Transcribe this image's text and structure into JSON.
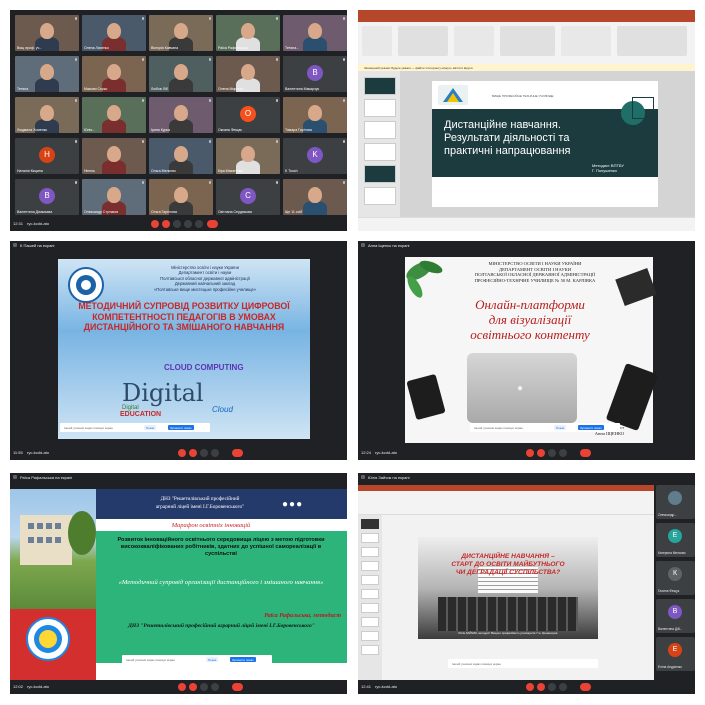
{
  "panels": {
    "p1": {
      "controls": {
        "time": "12:31",
        "code": "ryc-kcdd-ato"
      },
      "tiles": [
        {
          "name": "Вищ проф. уч..."
        },
        {
          "name": "Олена Лисенко"
        },
        {
          "name": "Вікторія Кавчана"
        },
        {
          "name": "Раїса Рафальська"
        },
        {
          "name": "Тетяна..."
        },
        {
          "name": "Тетяна"
        },
        {
          "name": "Максим Сєрко"
        },
        {
          "name": "Любов Ліб"
        },
        {
          "name": "Олена Мирошн..."
        },
        {
          "name": "Валентина Макарчук",
          "initial": "В",
          "color": "#7e57c2"
        },
        {
          "name": "Людмила Хоменко"
        },
        {
          "name": "Юлія..."
        },
        {
          "name": "Ірина Курка"
        },
        {
          "name": "Оксана Фещак",
          "initial": "О",
          "color": "#f4511e"
        },
        {
          "name": "Тамара Гарітова"
        },
        {
          "name": "Наталія Кікцина",
          "initial": "Н",
          "color": "#d84315"
        },
        {
          "name": "Нінель"
        },
        {
          "name": "Ольга Мельник"
        },
        {
          "name": "Кіра Макатенко"
        },
        {
          "name": "K Touch",
          "initial": "K",
          "color": "#7e57c2"
        },
        {
          "name": "Валентина Діхамьєва",
          "initial": "В",
          "color": "#7e57c2"
        },
        {
          "name": "Олександр Стуликов"
        },
        {
          "name": "Ольга Гаргінова"
        },
        {
          "name": "Світлана Сердюкова",
          "initial": "С",
          "color": "#7e57c2"
        },
        {
          "name": "Ще 11 осіб"
        }
      ]
    },
    "p2": {
      "slide": {
        "header": "ВИЩЕ ПРОФЕСІЙНЕ ТЕХНІЧНЕ УЧИЛИЩЕ",
        "title_lines": [
          "Дистанційне навчання.",
          "Результати діяльності та",
          "практичні напрацювання"
        ],
        "author_lines": [
          "Методист ВПТБУ",
          "Г. Полушенко"
        ]
      },
      "notice": "Захищений режим: Будьте уважні — файли з Інтернету можуть містити віруси."
    },
    "p3": {
      "presenter": "К Пашей на екрані",
      "controls": {
        "time": "11:55",
        "code": "ryc-kcdd-ato"
      },
      "slide": {
        "ministry_lines": [
          "Міністерство освіти і науки України",
          "Департамент освіти і науки",
          "Полтавської обласної державної адміністрації",
          "Державний навчальний заклад",
          "«Полтавське вище мистецьке професійне училище»"
        ],
        "title": "МЕТОДИЧНИЙ СУПРОВІД РОЗВИТКУ ЦИФРОВОЇ КОМПЕТЕНТНОСТІ ПЕДАГОГІВ В УМОВАХ ДИСТАНЦІЙНОГО ТА ЗМІШАНОГО НАВЧАННЯ",
        "cloud_words": [
          "CLOUD COMPUTING",
          "Digital",
          "EDUCATION",
          "Digital",
          "Cloud"
        ]
      },
      "banner": {
        "text": "Інший учасник зараз показує екран",
        "btn1": "Показ",
        "btn2": "Зупинити показ"
      }
    },
    "p4": {
      "presenter": "Анна Іщенко на екрані",
      "controls": {
        "time": "12:24",
        "code": "ryc-kcdd-ato"
      },
      "slide": {
        "header_lines": [
          "МІНІСТЕРСТВО ОСВІТИ І НАУКИ УКРАЇНИ",
          "ДЕПАРТАМЕНТ ОСВІТИ І НАУКИ",
          "ПОЛТАВСЬКОЇ ОБЛАСНОЇ ДЕРЖАВНОЇ АДМІНІСТРАЦІЇ",
          "ПРОФЕСІЙНО-ТЕХНІЧНЕ УЧИЛИЩЕ № 50 М. КАРЛІВКА"
        ],
        "title_lines": [
          "Онлайн-платформи",
          "для візуалізації",
          "освітнього контенту"
        ],
        "author_lines": [
          "Підготувала: методист",
          "Анна ІЩЕНКО"
        ]
      },
      "banner": {
        "text": "Інший учасник зараз показує екран",
        "btn1": "Показ",
        "btn2": "Зупинити показ"
      }
    },
    "p5": {
      "presenter": "Раїса Рафальська на екрані",
      "controls": {
        "time": "12:02",
        "code": "ryc-kcdd-ato"
      },
      "slide": {
        "school_lines": [
          "ДНЗ \"Решетилівський професійний",
          "аграрний ліцей імені І.Г.Боровенського\""
        ],
        "marathon": "Марафон освітніх інновацій",
        "subtitle": "Розвиток інноваційного освітнього середовища ліцею з метою підготовки висококваліфікованих робітників, здатних до успішної самореалізації в суспільстві",
        "topic": "«Методичний супровід організації дистанційного і змішаного навчання»",
        "author": "Раїса Рафальська, методист",
        "footer": "ДНЗ \"Решетилівський професійний аграрний ліцей імені І.Г.Боровенського\""
      },
      "banner": {
        "text": "Інший учасник зараз показує екран",
        "btn1": "Показ",
        "btn2": "Зупинити показ"
      }
    },
    "p6": {
      "presenter": "Юлія Зайчик на екрані",
      "controls": {
        "time": "12:41",
        "code": "ryc-kcdd-ato"
      },
      "slide": {
        "title_lines": [
          "ДИСТАНЦІЙНЕ НАВЧАННЯ –",
          "СТАРТ ДО ОСВІТИ МАЙБУТНЬОГО",
          "ЧИ ДЕГРАДАЦІЇ СУСПІЛЬСТВА?"
        ],
        "author": "Юлія ЗАЙЧИК, методист Вищого професійного училища № 7 м. Кременчука"
      },
      "side_people": [
        {
          "name": "Олександр...",
          "initial": "",
          "color": "#607d8b"
        },
        {
          "name": "Катерина Мельник",
          "initial": "Е",
          "color": "#26a69a"
        },
        {
          "name": "Галина Фещук",
          "initial": "К",
          "color": "#5f6368"
        },
        {
          "name": "Валентина Дій...",
          "initial": "В",
          "color": "#7e57c2"
        },
        {
          "name": "Еліна Андрієнко",
          "initial": "Е",
          "color": "#d84315"
        }
      ]
    }
  }
}
